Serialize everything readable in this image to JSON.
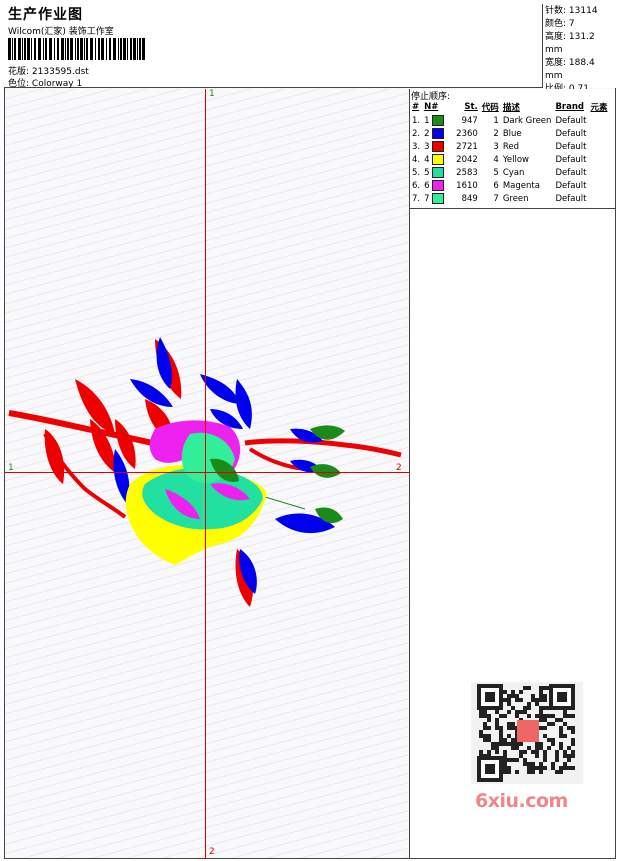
{
  "header": {
    "title": "生产作业图",
    "company": "Wilcom(汇家) 装饰工作室",
    "design_label": "花版:",
    "design_file": "2133595.dst",
    "colorway_label": "色位:",
    "colorway": "Colorway 1"
  },
  "stats": [
    {
      "label": "针数:",
      "value": "13114"
    },
    {
      "label": "颜色:",
      "value": "7"
    },
    {
      "label": "高度:",
      "value": "131.2 mm"
    },
    {
      "label": "宽度:",
      "value": "188.4 mm"
    },
    {
      "label": "比例:",
      "value": "0.71"
    }
  ],
  "color_table": {
    "section_title": "停止顺序:",
    "headers": [
      "#",
      "N#",
      "St.",
      "代码",
      "描述",
      "Brand",
      "元素"
    ],
    "rows": [
      {
        "idx": "1.",
        "n": "1",
        "color": "#1a8a1a",
        "st": "947",
        "code": "1",
        "desc": "Dark Green",
        "brand": "Default"
      },
      {
        "idx": "2.",
        "n": "2",
        "color": "#0000ee",
        "st": "2360",
        "code": "2",
        "desc": "Blue",
        "brand": "Default"
      },
      {
        "idx": "3.",
        "n": "3",
        "color": "#ee0000",
        "st": "2721",
        "code": "3",
        "desc": "Red",
        "brand": "Default"
      },
      {
        "idx": "4.",
        "n": "4",
        "color": "#ffff00",
        "st": "2042",
        "code": "4",
        "desc": "Yellow",
        "brand": "Default"
      },
      {
        "idx": "5.",
        "n": "5",
        "color": "#22e0a0",
        "st": "2583",
        "code": "5",
        "desc": "Cyan",
        "brand": "Default"
      },
      {
        "idx": "6.",
        "n": "6",
        "color": "#ee22ee",
        "st": "1610",
        "code": "6",
        "desc": "Magenta",
        "brand": "Default"
      },
      {
        "idx": "7.",
        "n": "7",
        "color": "#33ee99",
        "st": "849",
        "code": "7",
        "desc": "Green",
        "brand": "Default"
      }
    ]
  },
  "axes": {
    "top_label": "1",
    "bottom_label": "2",
    "left_label": "1",
    "right_label": "2"
  },
  "colors": {
    "crosshair": "#e00000",
    "border": "#444444"
  },
  "watermark": {
    "logo_text": "6xiu.com",
    "qr_icon": "qr-code-icon"
  }
}
